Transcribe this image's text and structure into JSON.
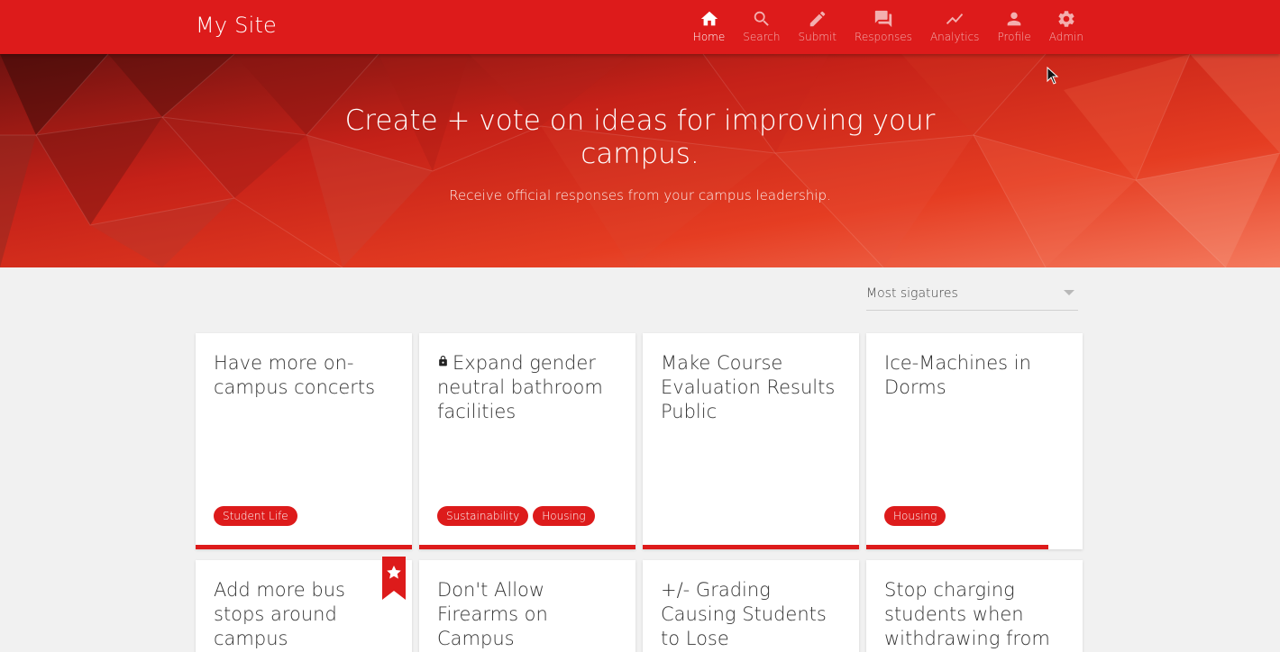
{
  "header": {
    "brand": "My Site",
    "nav": [
      {
        "label": "Home",
        "icon": "home-icon",
        "active": true
      },
      {
        "label": "Search",
        "icon": "search-icon"
      },
      {
        "label": "Submit",
        "icon": "pencil-icon"
      },
      {
        "label": "Responses",
        "icon": "chat-icon"
      },
      {
        "label": "Analytics",
        "icon": "trending-icon"
      },
      {
        "label": "Profile",
        "icon": "person-icon"
      },
      {
        "label": "Admin",
        "icon": "gear-icon"
      }
    ]
  },
  "hero": {
    "title": "Create + vote on ideas for improving your campus.",
    "subtitle": "Receive official responses from your campus leadership."
  },
  "sort": {
    "selected": "Most sigatures"
  },
  "cards": [
    {
      "title": "Have more on-campus concerts",
      "tags": [
        "Student Life"
      ],
      "progress": 1.0
    },
    {
      "title": "Expand gender neutral bathroom facilities",
      "locked": true,
      "tags": [
        "Sustainability",
        "Housing"
      ],
      "progress": 1.0
    },
    {
      "title": "Make Course Evaluation Results Public",
      "tags": [],
      "progress": 1.0
    },
    {
      "title": "Ice-Machines in Dorms",
      "tags": [
        "Housing"
      ],
      "progress": 0.84
    },
    {
      "title": "Add more bus stops around campus",
      "featured": true
    },
    {
      "title": "Don't Allow Firearms on Campus"
    },
    {
      "title": "+/- Grading Causing Students to Lose"
    },
    {
      "title": "Stop charging students when withdrawing from"
    }
  ],
  "colors": {
    "brand": "#dd1b1b"
  }
}
